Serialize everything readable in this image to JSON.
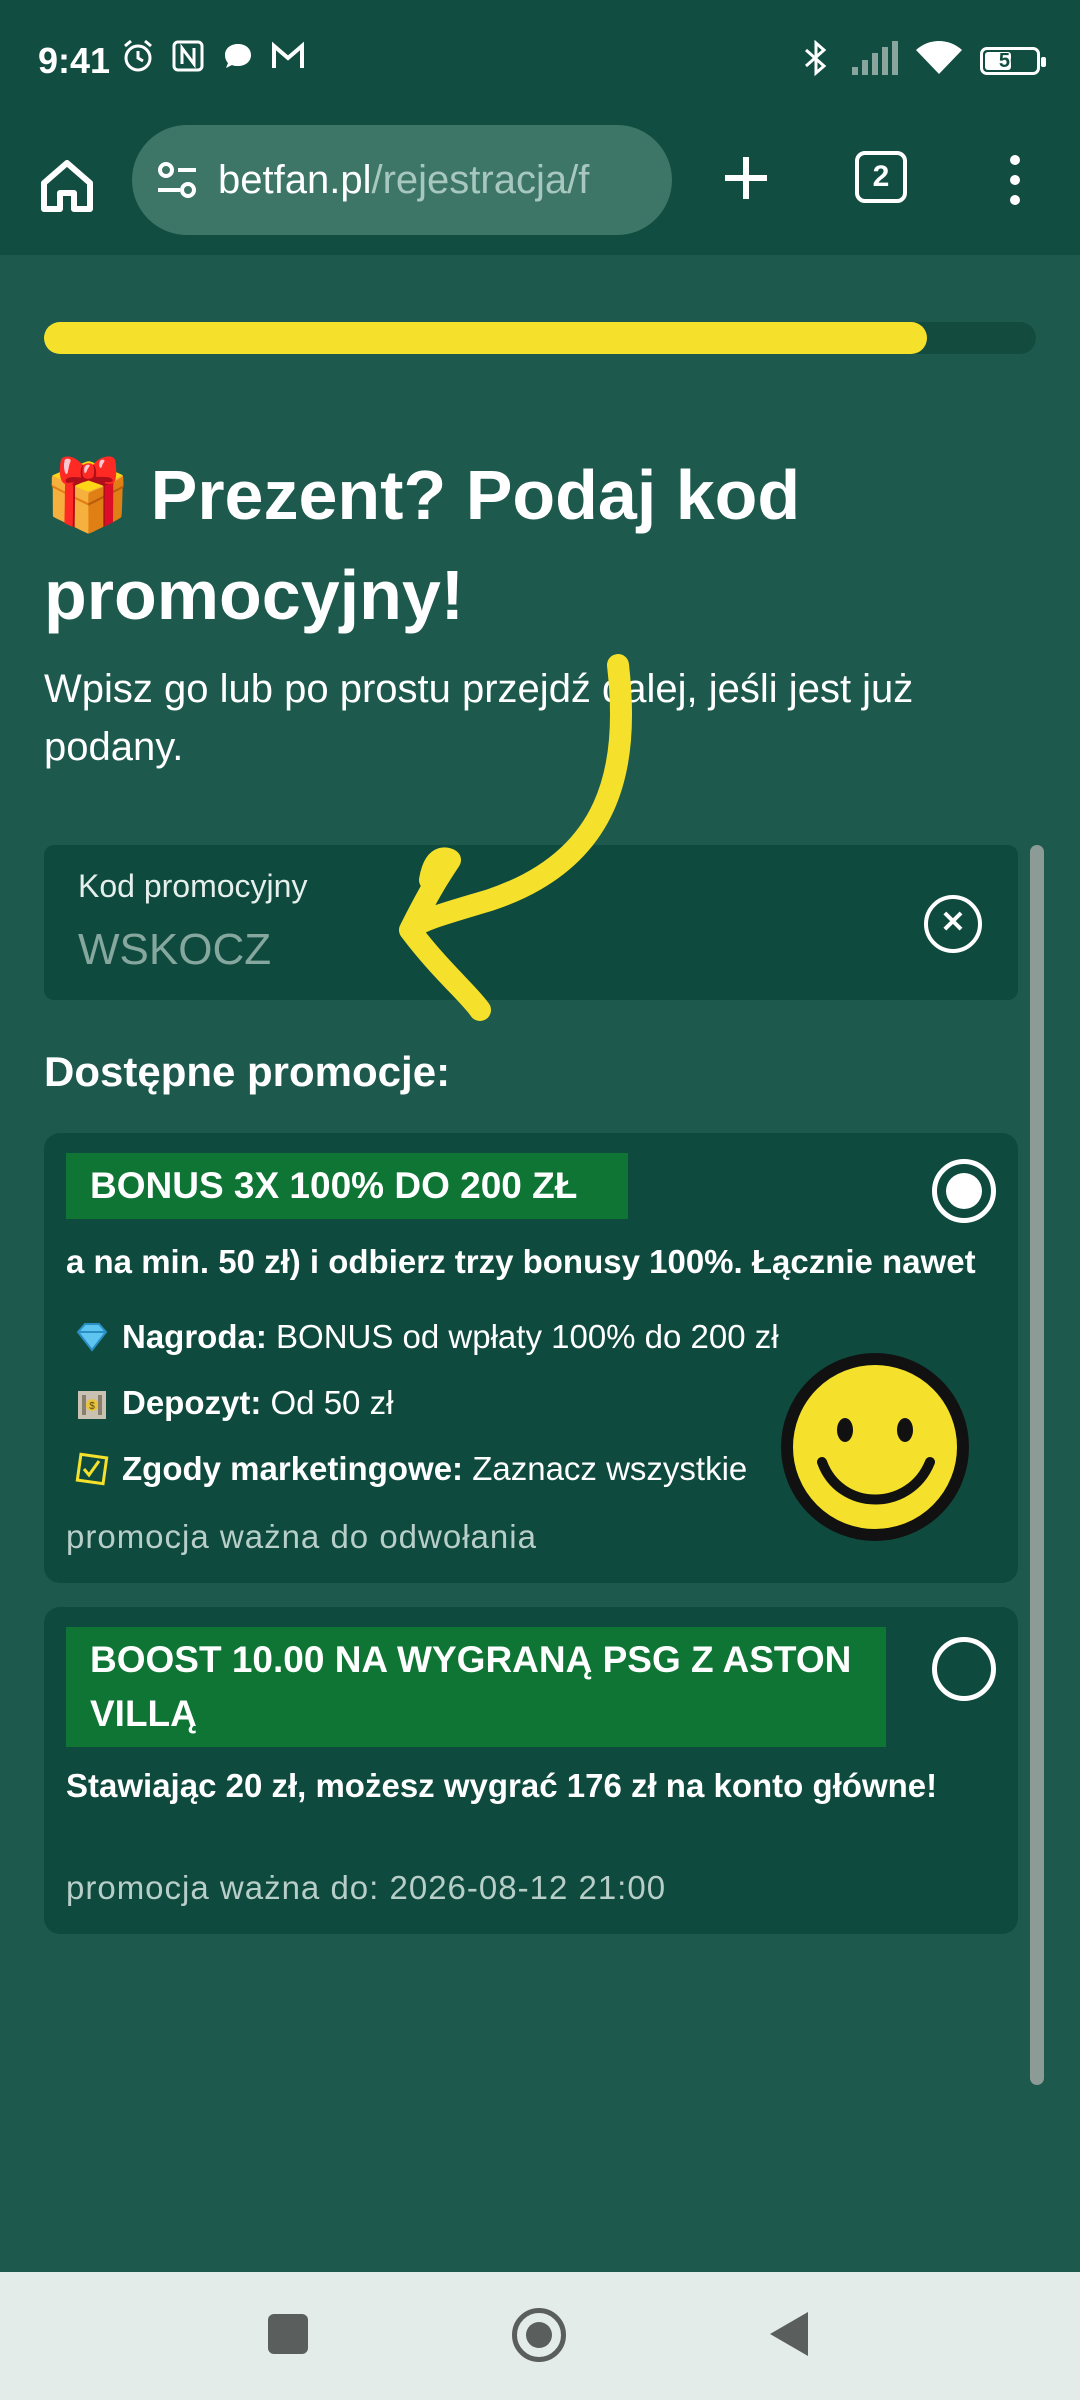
{
  "status_bar": {
    "time": "9:41",
    "battery": "56",
    "battery_level": 0.56
  },
  "browser": {
    "url_domain": "betfan.pl",
    "url_path": "/rejestracja/f",
    "tab_count": "2"
  },
  "page": {
    "progress": 0.89,
    "title_emoji": "🎁",
    "title": "Prezent? Podaj kod promocyjny!",
    "subtitle": "Wpisz go lub po prostu przejdź dalej, jeśli jest już podany.",
    "promo_field": {
      "label": "Kod promocyjny",
      "value": "WSKOCZ"
    },
    "section_heading": "Dostępne promocje:",
    "promotions": [
      {
        "badge": "BONUS 3X 100% DO 200 ZŁ",
        "selected": true,
        "description": "a na min. 50 zł) i odbierz trzy bonusy 100%. Łącznie nawet",
        "details": [
          {
            "icon": "diamond-icon",
            "label": "Nagroda:",
            "value": " BONUS od wpłaty 100% do 200 zł"
          },
          {
            "icon": "bank-icon",
            "label": "Depozyt:",
            "value": " Od 50 zł"
          },
          {
            "icon": "checkbox-icon",
            "label": "Zgody marketingowe:",
            "value": " Zaznacz wszystkie"
          }
        ],
        "validity": "promocja ważna do odwołania"
      },
      {
        "badge": "BOOST 10.00 NA WYGRANĄ PSG Z ASTON VILLĄ",
        "selected": false,
        "description": "Stawiając 20 zł, możesz wygrać 176 zł na konto główne!",
        "validity": "promocja ważna do: 2026-08-12 21:00"
      }
    ]
  },
  "colors": {
    "background": "#1d5a4d",
    "card": "#0f4a3e",
    "badge": "#0e7534",
    "progress": "#f5e12b"
  }
}
